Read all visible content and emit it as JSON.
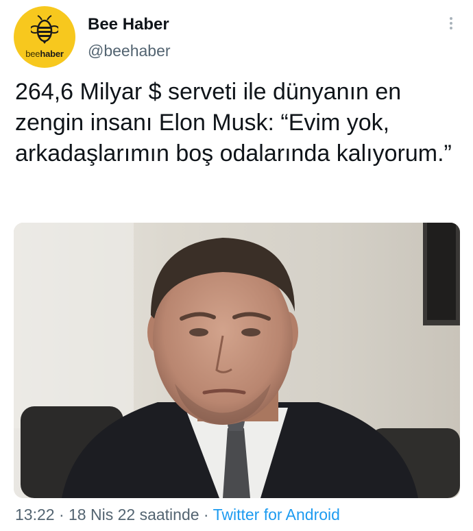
{
  "account": {
    "display_name": "Bee Haber",
    "handle": "@beehaber",
    "avatar_text_a": "bee",
    "avatar_text_b": "haber",
    "avatar_color": "#f7c81e"
  },
  "tweet": {
    "text": "264,6 Milyar $ serveti ile dünyanın en zengin insanı Elon Musk: “Evim yok, arkadaşlarımın boş odalarında kalıyorum.”",
    "media_icon": "photo-of-man-in-suit"
  },
  "footer": {
    "time": "13:22",
    "sep1": "·",
    "date": "18 Nis 22 saatinde",
    "sep2": "·",
    "source": "Twitter for Android",
    "source_color": "#1d9bf0"
  },
  "icons": {
    "more": "more-vertical-icon",
    "logo": "bee-logo-icon"
  }
}
